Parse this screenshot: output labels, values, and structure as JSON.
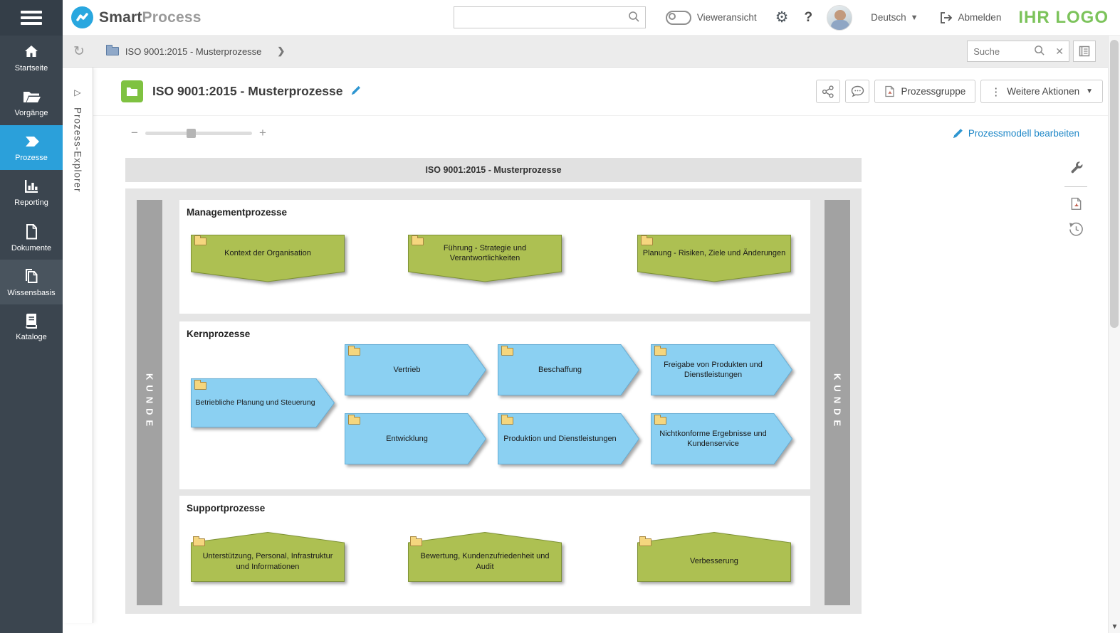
{
  "header": {
    "brand": {
      "bold": "Smart",
      "light": "Process"
    },
    "viewer_toggle_label": "Vieweransicht",
    "language": "Deutsch",
    "logout_label": "Abmelden",
    "customer_logo": "IHR LOGO"
  },
  "sidebar": {
    "items": [
      {
        "label": "Startseite",
        "icon": "home-icon"
      },
      {
        "label": "Vorgänge",
        "icon": "folder-open-icon"
      },
      {
        "label": "Prozesse",
        "icon": "process-arrow-icon"
      },
      {
        "label": "Reporting",
        "icon": "bar-chart-icon"
      },
      {
        "label": "Dokumente",
        "icon": "document-icon"
      },
      {
        "label": "Wissensbasis",
        "icon": "documents-stack-icon"
      },
      {
        "label": "Kataloge",
        "icon": "book-icon"
      }
    ]
  },
  "breadcrumb": {
    "item": "ISO 9001:2015 - Musterprozesse"
  },
  "toolbar": {
    "search_placeholder": "Suche"
  },
  "explorer": {
    "title": "Prozess-Explorer"
  },
  "page": {
    "title": "ISO 9001:2015 - Musterprozesse",
    "buttons": {
      "prozessgruppe": "Prozessgruppe",
      "weitere_aktionen": "Weitere Aktionen"
    },
    "edit_model_link": "Prozessmodell bearbeiten"
  },
  "diagram": {
    "title": "ISO 9001:2015 - Musterprozesse",
    "lane_left": "KUNDE",
    "lane_right": "KUNDE",
    "sections": [
      {
        "heading": "Managementprozesse",
        "shapes": [
          {
            "label": "Kontext der Organisation"
          },
          {
            "label": "Führung - Strategie und Verantwortlichkeiten"
          },
          {
            "label": "Planung - Risiken, Ziele und Änderungen"
          }
        ]
      },
      {
        "heading": "Kernprozesse",
        "shapes": [
          {
            "label": "Betriebliche Planung und Steuerung"
          },
          {
            "label": "Vertrieb"
          },
          {
            "label": "Beschaffung"
          },
          {
            "label": "Freigabe von Produkten und Dienstleistungen"
          },
          {
            "label": "Entwicklung"
          },
          {
            "label": "Produktion und Dienstleistungen"
          },
          {
            "label": "Nichtkonforme Ergebnisse und Kundenservice"
          }
        ]
      },
      {
        "heading": "Supportprozesse",
        "shapes": [
          {
            "label": "Unterstützung, Personal, Infrastruktur und Informationen"
          },
          {
            "label": "Bewertung, Kundenzufriedenheit und Audit"
          },
          {
            "label": "Verbesserung"
          }
        ]
      }
    ]
  },
  "icons": {
    "refresh": "↻",
    "clear": "✕",
    "chevron_right": "❯",
    "chevron_down": "▼",
    "gear": "⚙",
    "help": "?",
    "kebab": "⋮",
    "minus": "−",
    "plus": "+",
    "triangle_right": "▷",
    "down_arrow": "▼"
  },
  "colors": {
    "sidebar_bg": "#3b454f",
    "active_blue": "#2ba0da",
    "brand_blue": "#29a7df",
    "green_badge": "#7fc241",
    "customer_logo_green": "#7cc35b",
    "shape_green": "#adc052",
    "shape_green_border": "#7d9134",
    "shape_blue": "#8bd0f2",
    "shape_blue_border": "#65add5",
    "lane_gray": "#a2a2a2",
    "link_blue": "#1e87c7"
  }
}
